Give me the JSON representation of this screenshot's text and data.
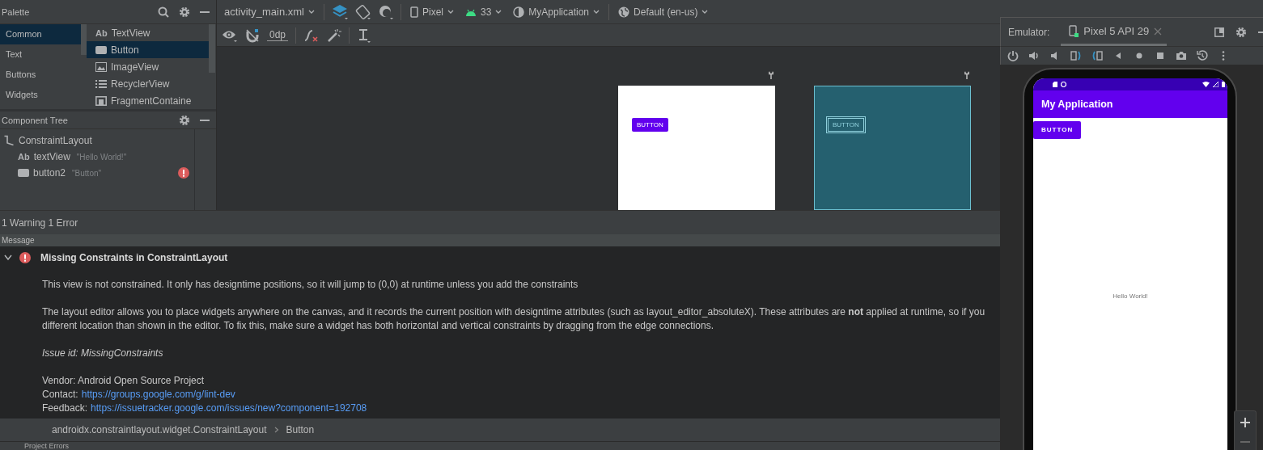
{
  "palette": {
    "title": "Palette",
    "categories": [
      {
        "label": "Common",
        "selected": true
      },
      {
        "label": "Text",
        "selected": false
      },
      {
        "label": "Buttons",
        "selected": false
      },
      {
        "label": "Widgets",
        "selected": false
      }
    ],
    "items": [
      {
        "kind": "text",
        "glyph": "Ab",
        "label": "TextView",
        "selected": false
      },
      {
        "kind": "button",
        "label": "Button",
        "selected": true
      },
      {
        "kind": "image",
        "label": "ImageView",
        "selected": false
      },
      {
        "kind": "list",
        "label": "RecyclerView",
        "selected": false
      },
      {
        "kind": "container",
        "label": "FragmentContaine",
        "selected": false
      }
    ]
  },
  "component_tree": {
    "title": "Component Tree",
    "nodes": [
      {
        "kind": "layout",
        "label": "ConstraintLayout",
        "error": false,
        "children": [
          {
            "kind": "text",
            "glyph": "Ab",
            "label": "textView",
            "text": "\"Hello World!\"",
            "error": false
          },
          {
            "kind": "button",
            "label": "button2",
            "text": "\"Button\"",
            "error": true
          }
        ]
      }
    ]
  },
  "editor_toolbar": {
    "file": "activity_main.xml",
    "device": "Pixel",
    "api_level": "33",
    "theme": "MyApplication",
    "locale": "Default (en-us)",
    "default_margin": "0dp"
  },
  "design_surface": {
    "design_button": "BUTTON",
    "blueprint_button": "BUTTON"
  },
  "problems": {
    "summary": "1 Warning 1 Error",
    "column": "Message",
    "issues": [
      {
        "error": true,
        "expanded": true,
        "title": "Missing Constraints in ConstraintLayout",
        "blocks": [
          {
            "kind": "text",
            "lines": [
              "This view is not constrained. It only has designtime positions, so it will jump to (0,0) at runtime unless you add the constraints"
            ]
          },
          {
            "kind": "text",
            "lines": [
              "The layout editor allows you to place widgets anywhere on the canvas, and it records the current position with designtime attributes (such as layout_editor_absoluteX). These attributes are **not** applied at runtime, so if you",
              "different location than shown in the editor. To fix this, make sure a widget has both horizontal and vertical constraints by dragging from the edge connections."
            ]
          },
          {
            "kind": "note",
            "lines": [
              "Issue id: MissingConstraints"
            ]
          },
          {
            "kind": "meta",
            "rows": [
              {
                "label": "Vendor: Android Open Source Project"
              },
              {
                "label": "Contact:",
                "link": "https://groups.google.com/g/lint-dev"
              },
              {
                "label": "Feedback:",
                "link": "https://issuetracker.google.com/issues/new?component=192708"
              }
            ]
          }
        ]
      }
    ]
  },
  "breadcrumb": [
    "androidx.constraintlayout.widget.ConstraintLayout",
    "Button"
  ],
  "bottom_tab": "Project Errors",
  "emulator": {
    "label": "Emulator:",
    "tabs": [
      {
        "label": "Pixel 5 API 29",
        "selected": true
      }
    ],
    "app_title": "My Application",
    "button": "BUTTON",
    "hello_text": "Hello World!"
  }
}
